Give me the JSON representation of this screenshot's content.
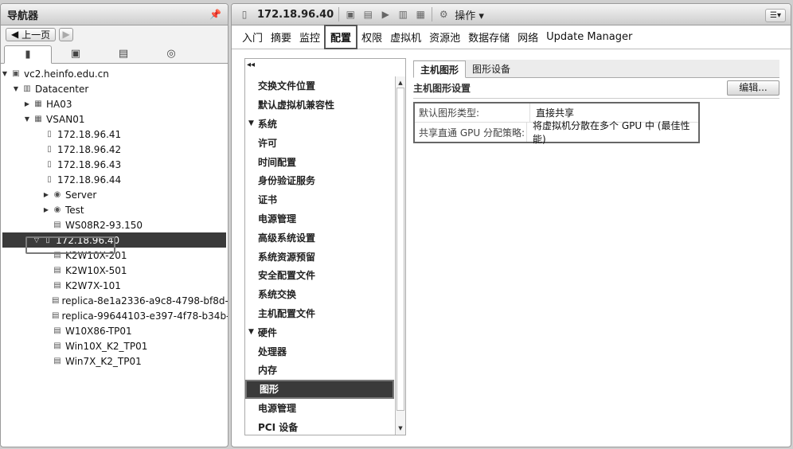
{
  "navigator": {
    "title": "导航器",
    "back_label": "上一页"
  },
  "tree": {
    "root": "vc2.heinfo.edu.cn",
    "datacenter": "Datacenter",
    "cluster1": "HA03",
    "cluster2": "VSAN01",
    "hosts": [
      "172.18.96.41",
      "172.18.96.42",
      "172.18.96.43",
      "172.18.96.44"
    ],
    "pools": [
      "Server",
      "Test"
    ],
    "vm_ws": "WS08R2-93.150",
    "selected_host": "172.18.96.40",
    "vms": [
      "K2W10X-201",
      "K2W10X-501",
      "K2W7X-101",
      "replica-8e1a2336-a9c8-4798-bf8d-...",
      "replica-99644103-e397-4f78-b34b-...",
      "W10X86-TP01",
      "Win10X_K2_TP01",
      "Win7X_K2_TP01"
    ]
  },
  "toolbar": {
    "host": "172.18.96.40",
    "actions": "操作"
  },
  "tabs": [
    "入门",
    "摘要",
    "监控",
    "配置",
    "权限",
    "虚拟机",
    "资源池",
    "数据存储",
    "网络",
    "Update Manager"
  ],
  "config_menu": {
    "items_top": [
      "交换文件位置",
      "默认虚拟机兼容性"
    ],
    "group_system": "系统",
    "system_items": [
      "许可",
      "时间配置",
      "身份验证服务",
      "证书",
      "电源管理",
      "高级系统设置",
      "系统资源预留",
      "安全配置文件",
      "系统交换",
      "主机配置文件"
    ],
    "group_hw": "硬件",
    "hw_items": [
      "处理器",
      "内存",
      "图形",
      "电源管理",
      "PCI 设备"
    ]
  },
  "graphics": {
    "tabs": [
      "主机图形",
      "图形设备"
    ],
    "section": "主机图形设置",
    "edit": "编辑...",
    "rows": [
      {
        "k": "默认图形类型:",
        "v": "直接共享"
      },
      {
        "k": "共享直通 GPU 分配策略:",
        "v": "将虚拟机分散在多个 GPU 中 (最佳性能)"
      }
    ]
  }
}
